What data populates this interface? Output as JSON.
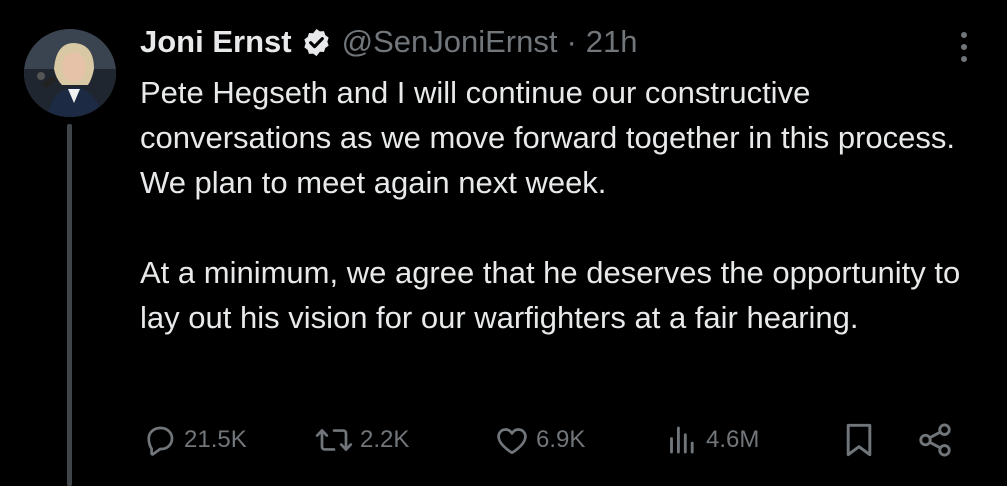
{
  "author": {
    "name": "Joni Ernst",
    "handle": "@SenJoniErnst",
    "separator": "·",
    "time": "21h",
    "verified": true
  },
  "tweet": {
    "paragraphs": [
      "Pete Hegseth and I will continue our constructive conversations as we move forward together in this process. We plan to meet again next week.",
      "At a minimum, we agree that he deserves the opportunity to lay out his vision for our warfighters at a fair hearing."
    ]
  },
  "metrics": {
    "replies": "21.5K",
    "reposts": "2.2K",
    "likes": "6.9K",
    "views": "4.6M"
  },
  "icons": {
    "reply": "reply-icon",
    "repost": "repost-icon",
    "like": "heart-icon",
    "views": "views-icon",
    "bookmark": "bookmark-icon",
    "share": "share-icon",
    "more": "more-options-icon",
    "verified": "verified-badge-icon"
  },
  "colors": {
    "background": "#000000",
    "text": "#e7e9ea",
    "muted": "#71767b",
    "thread_line": "#3f4448"
  }
}
